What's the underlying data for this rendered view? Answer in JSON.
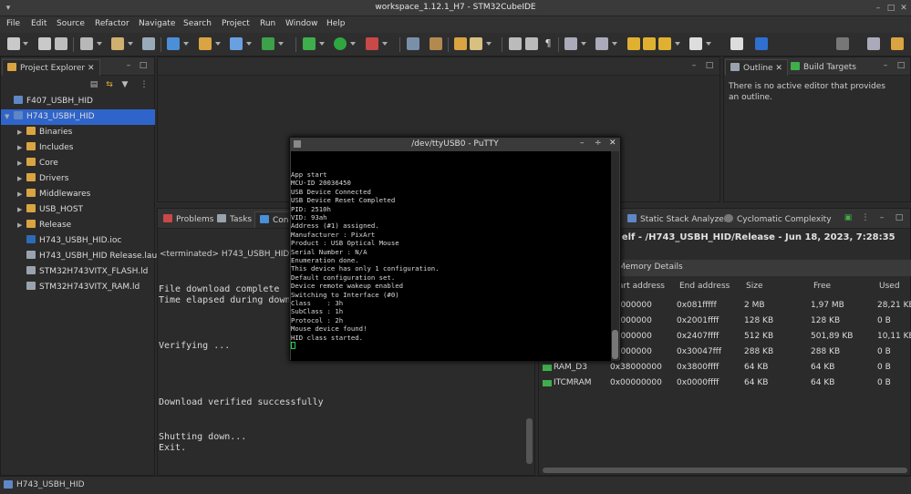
{
  "window": {
    "title": "workspace_1.12.1_H7 - STM32CubeIDE",
    "controls": [
      "–",
      "□",
      "✕"
    ]
  },
  "menu": [
    "File",
    "Edit",
    "Source",
    "Refactor",
    "Navigate",
    "Search",
    "Project",
    "Run",
    "Window",
    "Help"
  ],
  "project_explorer": {
    "tab_label": "Project Explorer",
    "items": [
      {
        "label": "F407_USBH_HID",
        "type": "project",
        "expanded": false
      },
      {
        "label": "H743_USBH_HID",
        "type": "project",
        "expanded": true,
        "selected": true
      },
      {
        "label": "Binaries",
        "type": "folder"
      },
      {
        "label": "Includes",
        "type": "folder"
      },
      {
        "label": "Core",
        "type": "folder"
      },
      {
        "label": "Drivers",
        "type": "folder"
      },
      {
        "label": "Middlewares",
        "type": "folder"
      },
      {
        "label": "USB_HOST",
        "type": "folder"
      },
      {
        "label": "Release",
        "type": "folder"
      },
      {
        "label": "H743_USBH_HID.ioc",
        "type": "mx"
      },
      {
        "label": "H743_USBH_HID Release.launch",
        "type": "file"
      },
      {
        "label": "STM32H743VITX_FLASH.ld",
        "type": "file"
      },
      {
        "label": "STM32H743VITX_RAM.ld",
        "type": "file"
      }
    ]
  },
  "outline": {
    "tab_outline": "Outline",
    "tab_build": "Build Targets",
    "message": "There is no active editor that provides an outline."
  },
  "console": {
    "tab_problems": "Problems",
    "tab_tasks": "Tasks",
    "tab_console": "Cons",
    "header": "<terminated> H743_USBH_HID Rele",
    "lines": [
      "File download complete",
      "Time elapsed during down",
      "Verifying ...",
      "Download verified successfully",
      "Shutting down...",
      "Exit."
    ]
  },
  "putty": {
    "title": "/dev/ttyUSB0 - PuTTY",
    "lines": [
      "App start",
      "MCU-ID 20036450",
      "USB Device Connected",
      "USB Device Reset Completed",
      "PID: 2510h",
      "VID: 93ah",
      "Address (#1) assigned.",
      "Manufacturer : PixArt",
      "Product : USB Optical Mouse",
      "Serial Number : N/A",
      "Enumeration done.",
      "This device has only 1 configuration.",
      "Default configuration set.",
      "Device remote wakeup enabled",
      "Switching to Interface (#0)",
      "Class    : 3h",
      "SubClass : 1h",
      "Protocol : 2h",
      "Mouse device found!",
      "HID class started."
    ]
  },
  "analyzer": {
    "tab_stack": "Static Stack Analyzer",
    "tab_cyclomatic": "Cyclomatic Complexity",
    "heading": ".elf - /H743_USBH_HID/Release - Jun 18, 2023, 7:28:35",
    "section": "Memory Details",
    "columns": [
      "art address",
      "End address",
      "Size",
      "Free",
      "Used"
    ],
    "rows": [
      {
        "name": "",
        "start": "08000000",
        "end": "0x081fffff",
        "size": "2 MB",
        "free": "1,97 MB",
        "used": "28,21 KE"
      },
      {
        "name": "",
        "start": "20000000",
        "end": "0x2001ffff",
        "size": "128 KB",
        "free": "128 KB",
        "used": "0 B"
      },
      {
        "name": "",
        "start": "24000000",
        "end": "0x2407ffff",
        "size": "512 KB",
        "free": "501,89 KB",
        "used": "10,11 KE"
      },
      {
        "name": "",
        "start": "30000000",
        "end": "0x30047fff",
        "size": "288 KB",
        "free": "288 KB",
        "used": "0 B"
      },
      {
        "name": "RAM_D3",
        "start": "0x38000000",
        "end": "0x3800ffff",
        "size": "64 KB",
        "free": "64 KB",
        "used": "0 B"
      },
      {
        "name": "ITCMRAM",
        "start": "0x00000000",
        "end": "0x0000ffff",
        "size": "64 KB",
        "free": "64 KB",
        "used": "0 B"
      }
    ]
  },
  "status": {
    "project": "H743_USBH_HID"
  }
}
